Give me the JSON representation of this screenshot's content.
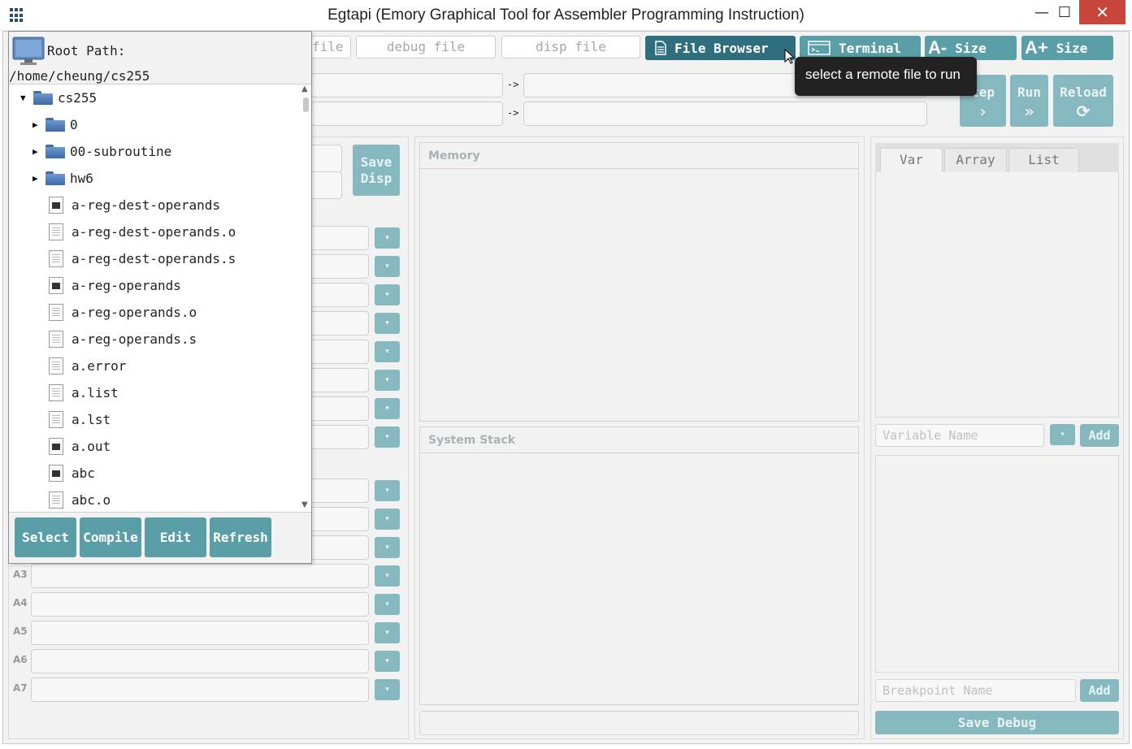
{
  "window": {
    "title": "Egtapi (Emory Graphical Tool for Assembler Programming Instruction)",
    "min_glyph": "—",
    "max_glyph": "☐",
    "close_glyph": "✕"
  },
  "toolbar": {
    "run_file_placeholder": "file",
    "debug_file_placeholder": "debug file",
    "disp_file_placeholder": "disp file",
    "file_browser_label": "File Browser",
    "terminal_label": "Terminal",
    "size_down_icon": "A-",
    "size_down_label": "Size",
    "size_up_icon": "A+",
    "size_up_label": "Size",
    "arrow_glyph": "->"
  },
  "controls": {
    "step_label": "tep",
    "step_symbol": "›",
    "run_label": "Run",
    "run_symbol": "»",
    "reload_label": "Reload",
    "reload_symbol": "⟳"
  },
  "tooltip": {
    "text": "select a remote file to run"
  },
  "left": {
    "save_disp_label_1": "Save",
    "save_disp_label_2": "Disp",
    "registers": [
      {
        "label": "A3"
      },
      {
        "label": "A4"
      },
      {
        "label": "A5"
      },
      {
        "label": "A6"
      },
      {
        "label": "A7"
      }
    ],
    "drop_glyph": "▾"
  },
  "center": {
    "memory_title": "Memory",
    "stack_title": "System Stack"
  },
  "right": {
    "tabs": [
      "Var",
      "Array",
      "List"
    ],
    "variable_placeholder": "Variable Name",
    "add_label": "Add",
    "breakpoint_placeholder": "Breakpoint Name",
    "add_bp_label": "Add",
    "save_debug_label": "Save Debug"
  },
  "browser": {
    "root_label": "Root Path:",
    "root_path": "/home/cheung/cs255",
    "tree": [
      {
        "name": "cs255",
        "kind": "folder",
        "expanded": true,
        "depth": 0
      },
      {
        "name": "0",
        "kind": "folder",
        "expanded": false,
        "depth": 1
      },
      {
        "name": "00-subroutine",
        "kind": "folder",
        "expanded": false,
        "depth": 1
      },
      {
        "name": "hw6",
        "kind": "folder",
        "expanded": false,
        "depth": 1
      },
      {
        "name": "a-reg-dest-operands",
        "kind": "exe",
        "depth": 1
      },
      {
        "name": "a-reg-dest-operands.o",
        "kind": "txt",
        "depth": 1
      },
      {
        "name": "a-reg-dest-operands.s",
        "kind": "txt",
        "depth": 1
      },
      {
        "name": "a-reg-operands",
        "kind": "exe",
        "depth": 1
      },
      {
        "name": "a-reg-operands.o",
        "kind": "txt",
        "depth": 1
      },
      {
        "name": "a-reg-operands.s",
        "kind": "txt",
        "depth": 1
      },
      {
        "name": "a.error",
        "kind": "txt",
        "depth": 1
      },
      {
        "name": "a.list",
        "kind": "txt",
        "depth": 1
      },
      {
        "name": "a.lst",
        "kind": "txt",
        "depth": 1
      },
      {
        "name": "a.out",
        "kind": "exe",
        "depth": 1
      },
      {
        "name": "abc",
        "kind": "exe",
        "depth": 1
      },
      {
        "name": "abc.o",
        "kind": "txt",
        "depth": 1
      }
    ],
    "expanded_glyph": "▼",
    "collapsed_glyph": "▶",
    "actions": [
      "Select",
      "Compile",
      "Edit",
      "Refresh"
    ]
  },
  "colors": {
    "accent": "#5a9fa7",
    "accent_dark": "#2f6f7d",
    "accent_disabled": "#86b9bf",
    "close": "#c7453b",
    "tooltip_bg": "#222222"
  }
}
